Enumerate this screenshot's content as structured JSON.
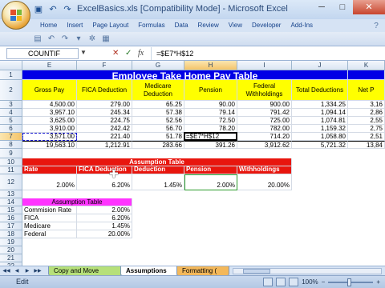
{
  "window": {
    "title": "ExcelBasics.xls  [Compatibility Mode]  -  Microsoft Excel",
    "minimize": "─",
    "maximize": "□",
    "close": "✕"
  },
  "qat": [
    {
      "name": "save-icon",
      "glyph": "💾"
    },
    {
      "name": "undo-icon",
      "glyph": "↶"
    },
    {
      "name": "redo-icon",
      "glyph": "↷"
    }
  ],
  "ribbon": {
    "tabs": [
      "Home",
      "Insert",
      "Page Layout",
      "Formulas",
      "Data",
      "Review",
      "View",
      "Developer",
      "Add-Ins"
    ]
  },
  "formula_bar": {
    "name_box": "COUNTIF",
    "cancel": "✕",
    "enter": "✓",
    "fx": "fx",
    "formula": "=$E7*H$12"
  },
  "columns": [
    "E",
    "F",
    "G",
    "H",
    "I",
    "J",
    "K"
  ],
  "rows": [
    "1",
    "2",
    "3",
    "4",
    "5",
    "6",
    "7",
    "8",
    "9",
    "10",
    "11",
    "12",
    "13",
    "14",
    "15",
    "16",
    "17",
    "18",
    "19",
    "20",
    "21",
    "22"
  ],
  "table": {
    "title": "Employee Take Home Pay Table",
    "headers": [
      "Gross Pay",
      "FICA Deduction",
      "Medicare Deduction",
      "Pension",
      "Federal Withholdings",
      "Total Deductions",
      "Net P"
    ],
    "data": [
      [
        "4,500.00",
        "279.00",
        "65.25",
        "90.00",
        "900.00",
        "1,334.25",
        "3,16"
      ],
      [
        "3,957.10",
        "245.34",
        "57.38",
        "79.14",
        "791.42",
        "1,094.14",
        "2,86"
      ],
      [
        "3,625.00",
        "224.75",
        "52.56",
        "72.50",
        "725.00",
        "1,074.81",
        "2,55"
      ],
      [
        "3,910.00",
        "242.42",
        "56.70",
        "78.20",
        "782.00",
        "1,159.32",
        "2,75"
      ],
      [
        "3,571.00",
        "221.40",
        "51.78",
        "=$E7*H$12",
        "714.20",
        "1,058.80",
        "2,51"
      ],
      [
        "19,563.10",
        "1,212.91",
        "283.66",
        "391.26",
        "3,912.62",
        "5,721.32",
        "13,84"
      ]
    ]
  },
  "assumption_table": {
    "title": "Assumption Table",
    "headers": [
      "Commission Rate",
      "FICA Deduction",
      "Medicare Deduction",
      "Pension",
      "Federal Withholdings"
    ],
    "values": [
      "2.00%",
      "6.20%",
      "1.45%",
      "2.00%",
      "20.00%"
    ]
  },
  "small_table": {
    "title": "Assumption Table",
    "rows": [
      [
        "Commision Rate",
        "2.00%"
      ],
      [
        "FICA",
        "6.20%"
      ],
      [
        "Medicare",
        "1.45%"
      ],
      [
        "Federal",
        "20.00%"
      ]
    ]
  },
  "sheets": [
    {
      "label": "Copy and Move",
      "color": "green"
    },
    {
      "label": "Assumptions",
      "color": "active"
    },
    {
      "label": "Formatting (",
      "color": "orange"
    }
  ],
  "status": {
    "mode": "Edit",
    "zoom": "100%",
    "minus": "−",
    "plus": "+"
  },
  "colors": {
    "title_blue": "#0000e6",
    "header_yellow": "#ffff00",
    "assumption_red": "#e8160e",
    "small_table_magenta": "#ff33ff"
  }
}
